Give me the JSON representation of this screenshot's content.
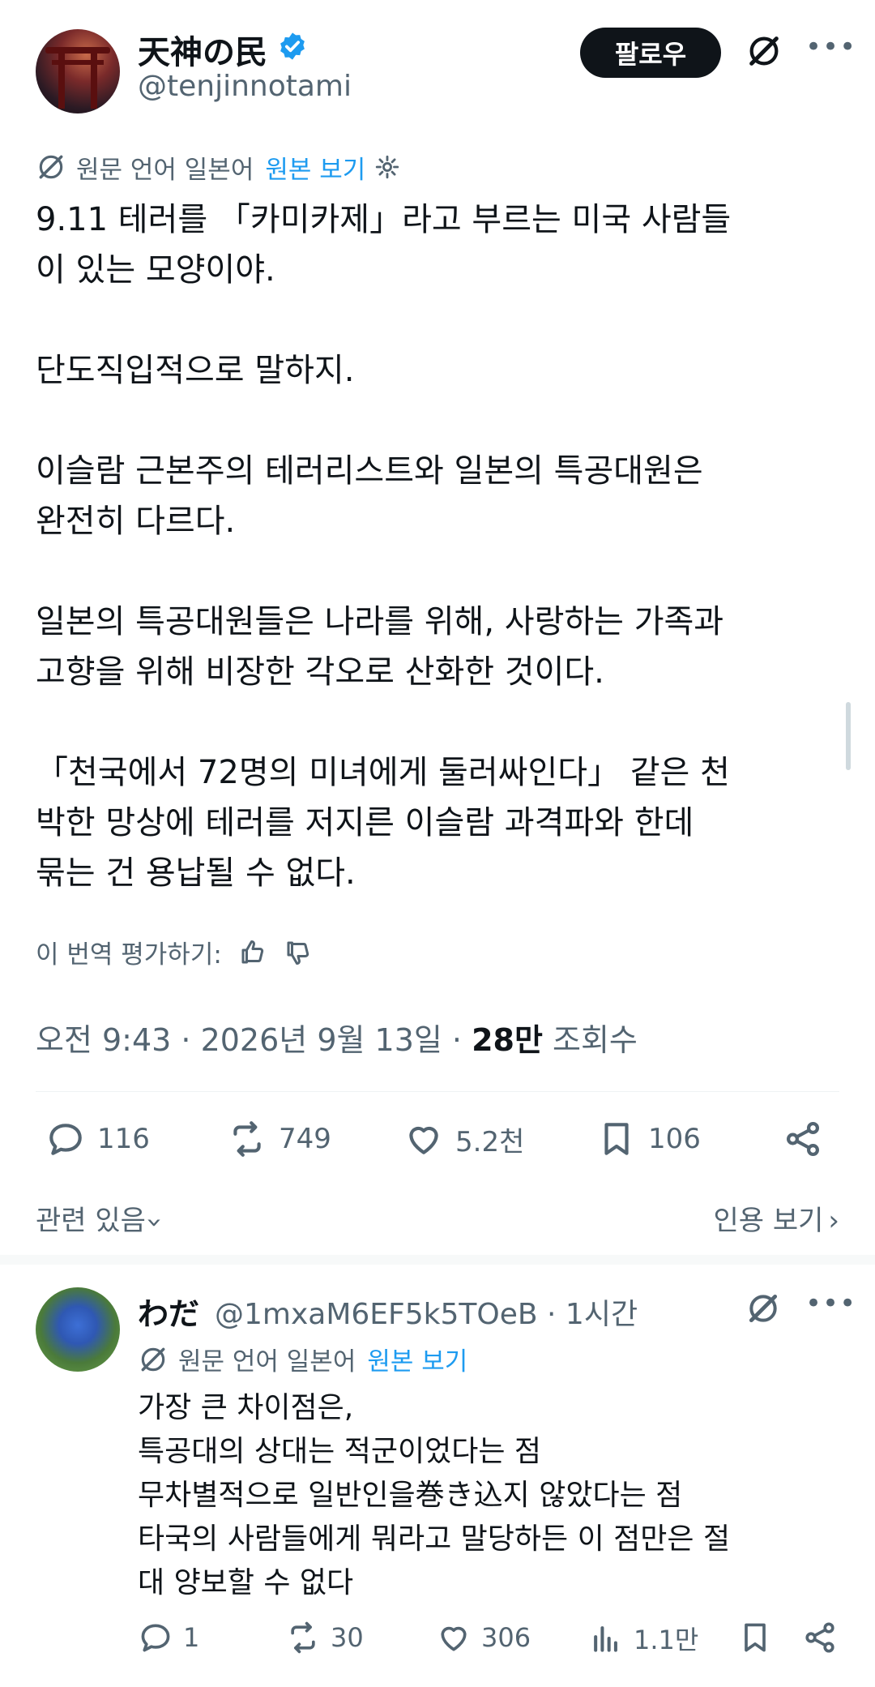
{
  "tweet": {
    "author_name": "天神の民",
    "author_handle": "@tenjinnotami",
    "follow_label": "팔로우",
    "translation": {
      "original_language": "원문 언어 일본어",
      "view_original": "원본 보기"
    },
    "body": [
      "9.11 테러를 「카미카제」라고 부르는 미국 사람들\n이 있는 모양이야.",
      "단도직입적으로 말하지.",
      "이슬람 근본주의 테러리스트와 일본의 특공대원은\n완전히 다르다.",
      "일본의 특공대원들은 나라를 위해, 사랑하는 가족과\n고향을 위해 비장한 각오로 산화한 것이다.",
      "「천국에서 72명의 미녀에게 둘러싸인다」 같은 천\n박한 망상에 테러를 저지른 이슬람 과격파와 한데\n묶는 건 용납될 수 없다."
    ],
    "rate_translation": "이 번역 평가하기:",
    "meta": {
      "time_date": "오전 9:43 · 2026년 9월 13일 · ",
      "views": "28만",
      "views_label": " 조회수"
    },
    "stats": {
      "replies": "116",
      "retweets": "749",
      "likes": "5.2천",
      "bookmarks": "106"
    },
    "related_label": "관련 있음",
    "quotes_label": "인용 보기"
  },
  "reply": {
    "author_name": "わだ",
    "author_handle": "@1mxaM6EF5k5TOeB · 1시간",
    "translation": {
      "original_language": "원문 언어 일본어",
      "view_original": "원본 보기"
    },
    "body": [
      "가장 큰 차이점은,",
      "특공대의 상대는 적군이었다는 점",
      "무차별적으로 일반인을巻き込지 않았다는 점",
      "타국의 사람들에게 뭐라고 말당하든 이 점만은 절",
      "대 양보할 수 없다"
    ],
    "stats": {
      "replies": "1",
      "retweets": "30",
      "likes": "306",
      "views": "1.1만"
    }
  },
  "colors": {
    "accent": "#1d9bf0",
    "text": "#0f1419",
    "secondary": "#536471",
    "divider": "#eff3f4"
  }
}
